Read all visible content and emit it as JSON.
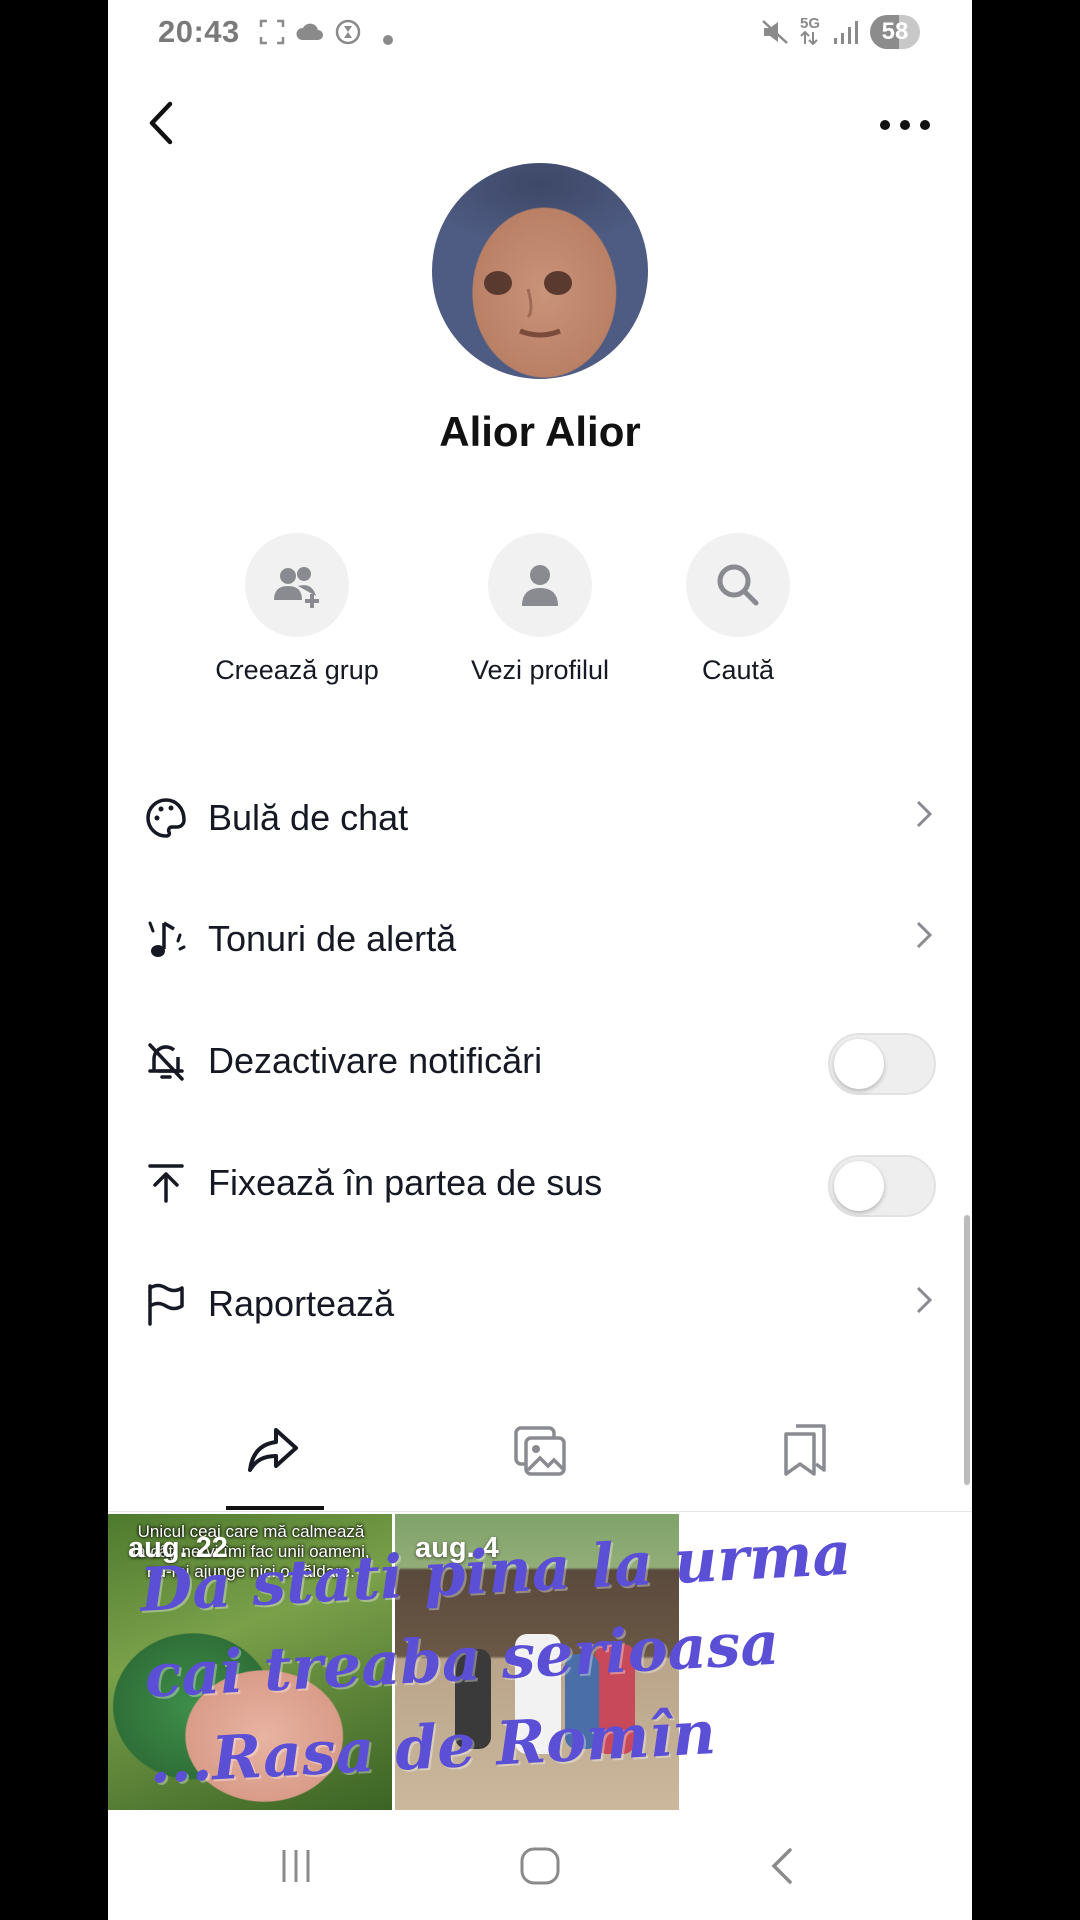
{
  "status_bar": {
    "time": "20:43",
    "network": "5G",
    "battery": "58",
    "icons": [
      "screenshot-icon",
      "cloud-icon",
      "timer-icon",
      "dot-icon",
      "mute-icon",
      "5g-icon",
      "signal-icon",
      "battery-icon"
    ]
  },
  "header": {
    "back_icon": "chevron-left-icon",
    "more_icon": "ellipsis-icon"
  },
  "profile": {
    "name": "Alior Alior"
  },
  "quick_actions": [
    {
      "label": "Creează grup",
      "icon": "add-group-icon"
    },
    {
      "label": "Vezi profilul",
      "icon": "person-icon"
    },
    {
      "label": "Caută",
      "icon": "search-icon"
    }
  ],
  "menu": [
    {
      "label": "Bulă de chat",
      "icon": "palette-icon",
      "control": "chevron"
    },
    {
      "label": "Tonuri de alertă",
      "icon": "music-note-icon",
      "control": "chevron"
    },
    {
      "label": "Dezactivare notificări",
      "icon": "bell-off-icon",
      "control": "toggle",
      "on": false
    },
    {
      "label": "Fixează în partea de sus",
      "icon": "pin-to-top-icon",
      "control": "toggle",
      "on": false
    },
    {
      "label": "Raportează",
      "icon": "flag-icon",
      "control": "chevron"
    }
  ],
  "tabs": [
    {
      "icon": "share-icon",
      "selected": true
    },
    {
      "icon": "gallery-icon",
      "selected": false
    },
    {
      "icon": "bookmark-stack-icon",
      "selected": false
    }
  ],
  "grid": [
    {
      "date": "aug. 22",
      "caption": "Unicul ceai care mă calmează la câți nervi îmi fac unii oameni, nu-mi ajunge nici o căldare."
    },
    {
      "date": "aug. 4"
    }
  ],
  "overlay_text": "Da stati pina la urma cai treaba serioasa ...Rasa de Romîn",
  "nav_bar": {
    "icons": [
      "recent-apps-icon",
      "home-icon",
      "back-icon"
    ]
  },
  "colors": {
    "background": "#ffffff",
    "text": "#161823",
    "overlay_text": "#5b4fd6",
    "toggle_off": "#eeeeef"
  }
}
